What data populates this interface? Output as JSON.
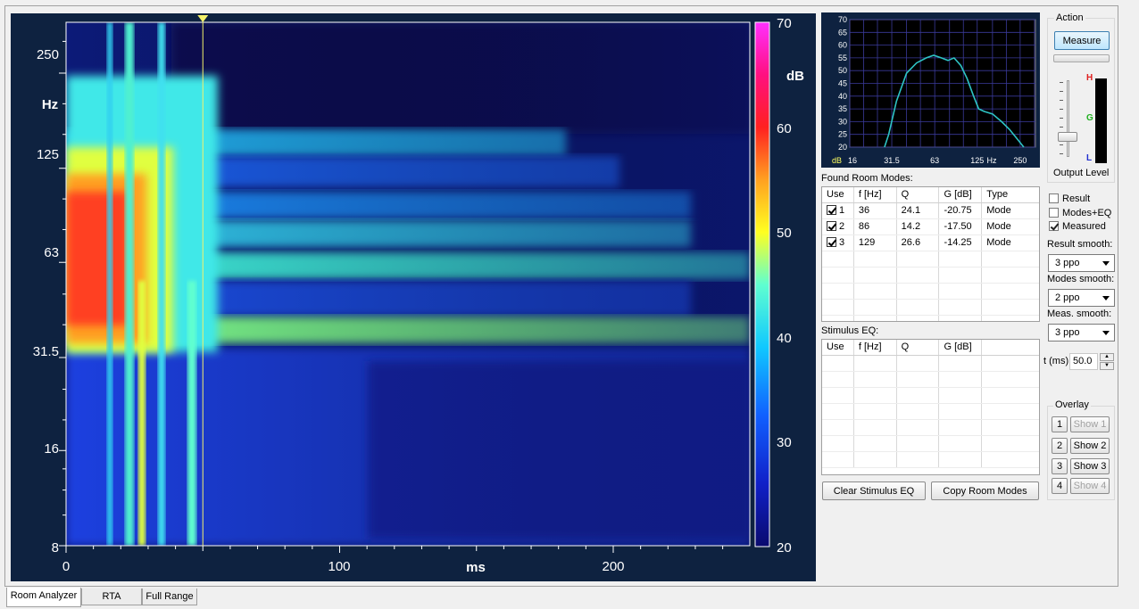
{
  "spectrogram": {
    "y_ticks": [
      "250",
      "125",
      "63",
      "31.5",
      "16",
      "8"
    ],
    "y_unit": "Hz",
    "x_ticks": [
      "0",
      "100",
      "200"
    ],
    "x_unit": "ms",
    "colorbar_ticks": [
      "70",
      "60",
      "50",
      "40",
      "30",
      "20"
    ],
    "colorbar_unit": "dB",
    "cursor_ms": 50
  },
  "mini_plot": {
    "y_ticks": [
      "70",
      "65",
      "60",
      "55",
      "50",
      "45",
      "40",
      "35",
      "30",
      "25",
      "20"
    ],
    "x_ticks": [
      "16",
      "31.5",
      "63",
      "125",
      "250"
    ],
    "x_unit": "Hz",
    "y_unit": "dB",
    "curve_color": "#2ec4c4"
  },
  "action": {
    "title": "Action",
    "measure_label": "Measure",
    "level_labels": {
      "high": "H",
      "good": "G",
      "low": "L"
    },
    "output_level_label": "Output Level"
  },
  "modes": {
    "title": "Found Room Modes:",
    "headers": [
      "Use",
      "f [Hz]",
      "Q",
      "G [dB]",
      "Type"
    ],
    "rows": [
      {
        "use": "1",
        "f": "36",
        "q": "24.1",
        "g": "-20.75",
        "type": "Mode"
      },
      {
        "use": "2",
        "f": "86",
        "q": "14.2",
        "g": "-17.50",
        "type": "Mode"
      },
      {
        "use": "3",
        "f": "129",
        "q": "26.6",
        "g": "-14.25",
        "type": "Mode"
      }
    ]
  },
  "stimulus": {
    "title": "Stimulus EQ:",
    "headers": [
      "Use",
      "f [Hz]",
      "Q",
      "G [dB]"
    ]
  },
  "buttons": {
    "clear_stimulus": "Clear Stimulus EQ",
    "copy_modes": "Copy Room Modes"
  },
  "display": {
    "result_label": "Result",
    "modes_eq_label": "Modes+EQ",
    "measured_label": "Measured",
    "result_smooth_label": "Result smooth:",
    "result_smooth_value": "3 ppo",
    "modes_smooth_label": "Modes smooth:",
    "modes_smooth_value": "2 ppo",
    "meas_smooth_label": "Meas. smooth:",
    "meas_smooth_value": "3 ppo",
    "t_label": "t (ms)",
    "t_value": "50.0"
  },
  "overlay": {
    "title": "Overlay",
    "items": [
      {
        "num": "1",
        "label": "Show 1"
      },
      {
        "num": "2",
        "label": "Show 2"
      },
      {
        "num": "3",
        "label": "Show 3"
      },
      {
        "num": "4",
        "label": "Show 4"
      }
    ]
  },
  "tabs": [
    "Room Analyzer",
    "RTA",
    "Full Range"
  ]
}
